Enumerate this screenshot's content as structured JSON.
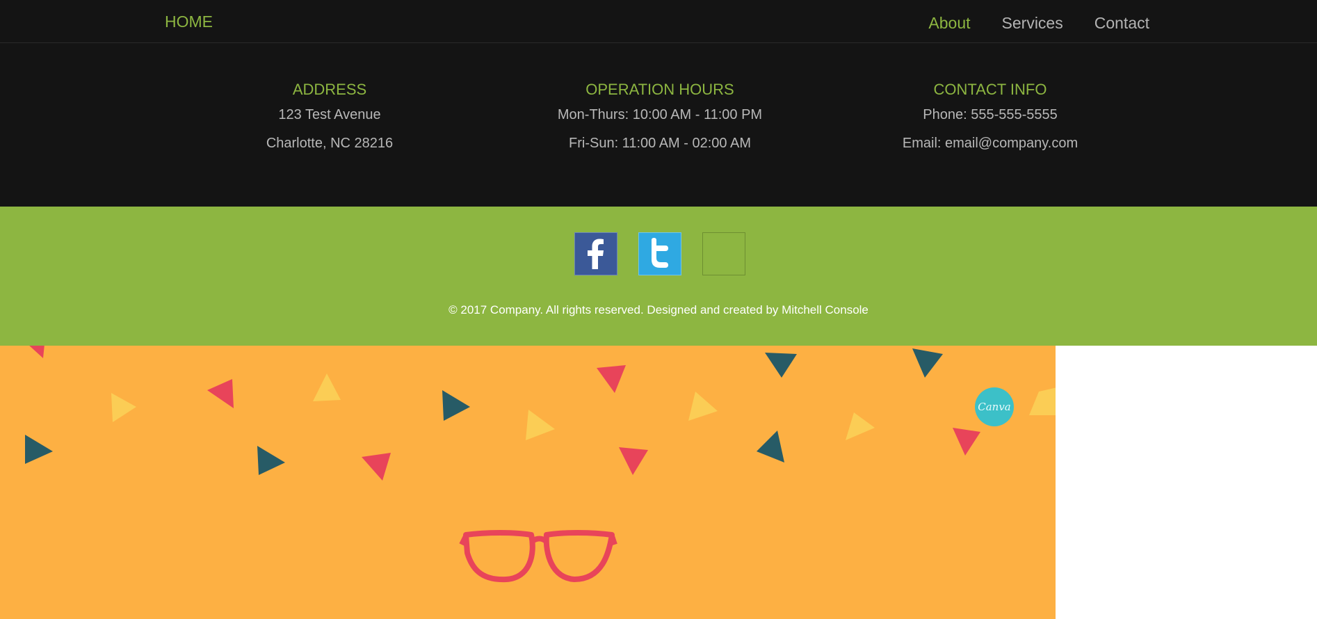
{
  "nav": {
    "brand": "HOME",
    "links": [
      {
        "label": "About",
        "active": true
      },
      {
        "label": "Services",
        "active": false
      },
      {
        "label": "Contact",
        "active": false
      }
    ]
  },
  "info": {
    "address": {
      "title": "ADDRESS",
      "lines": [
        "123 Test Avenue",
        "Charlotte, NC 28216"
      ]
    },
    "hours": {
      "title": "OPERATION HOURS",
      "lines": [
        "Mon-Thurs: 10:00 AM - 11:00 PM",
        "Fri-Sun: 11:00 AM - 02:00 AM"
      ]
    },
    "contact": {
      "title": "CONTACT INFO",
      "lines": [
        "Phone: 555-555-5555",
        "Email: email@company.com"
      ]
    }
  },
  "social": {
    "icons": [
      "facebook-icon",
      "twitter-icon",
      "empty-social-icon"
    ],
    "copyright": "© 2017 Company. All rights reserved. Designed and created by Mitchell Console"
  },
  "banner": {
    "badge": "Canva"
  },
  "colors": {
    "accent": "#8db641",
    "dark": "#141414",
    "banner_bg": "#fdb043",
    "facebook": "#3b5998",
    "twitter": "#2fa9e2"
  }
}
